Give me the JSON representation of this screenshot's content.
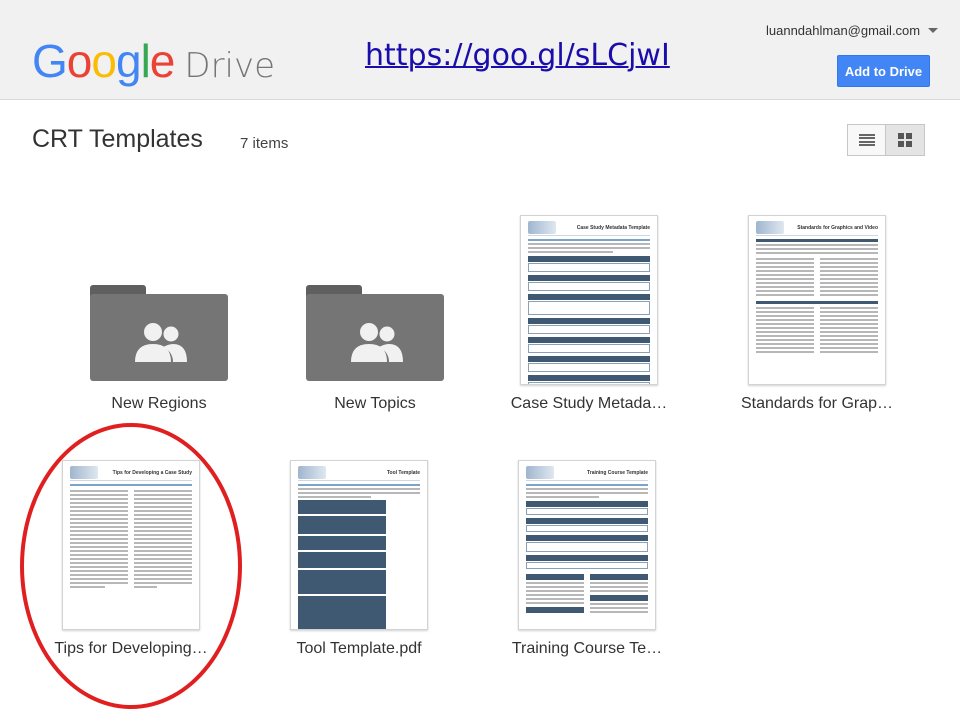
{
  "header": {
    "logo_google": "Google",
    "logo_product": "Drive",
    "short_link": "https://goo.gl/sLCjwI",
    "account_email": "luanndahlman@gmail.com",
    "add_button_label": "Add to Drive",
    "accent_color": "#4285f4"
  },
  "folder": {
    "title": "CRT Templates",
    "count_label": "7 items"
  },
  "view_toggle": {
    "list_icon": "list-view-icon",
    "grid_icon": "grid-view-icon",
    "active": "grid"
  },
  "items": [
    {
      "name": "New Regions",
      "type": "shared-folder",
      "icon": "shared-folder-icon"
    },
    {
      "name": "New Topics",
      "type": "shared-folder",
      "icon": "shared-folder-icon"
    },
    {
      "name": "Case Study Metada…",
      "type": "pdf",
      "preview_title": "Case Study Metadata Template"
    },
    {
      "name": "Standards for Grap…",
      "type": "pdf",
      "preview_title": "Standards for Graphics and Video"
    },
    {
      "name": "Tips for Developing…",
      "type": "pdf",
      "preview_title": "Tips for Developing a Case Study",
      "highlighted": true
    },
    {
      "name": "Tool Template.pdf",
      "type": "pdf",
      "preview_title": "Tool Template"
    },
    {
      "name": "Training Course Te…",
      "type": "pdf",
      "preview_title": "Training Course Template"
    }
  ],
  "highlight_color": "#e02020"
}
